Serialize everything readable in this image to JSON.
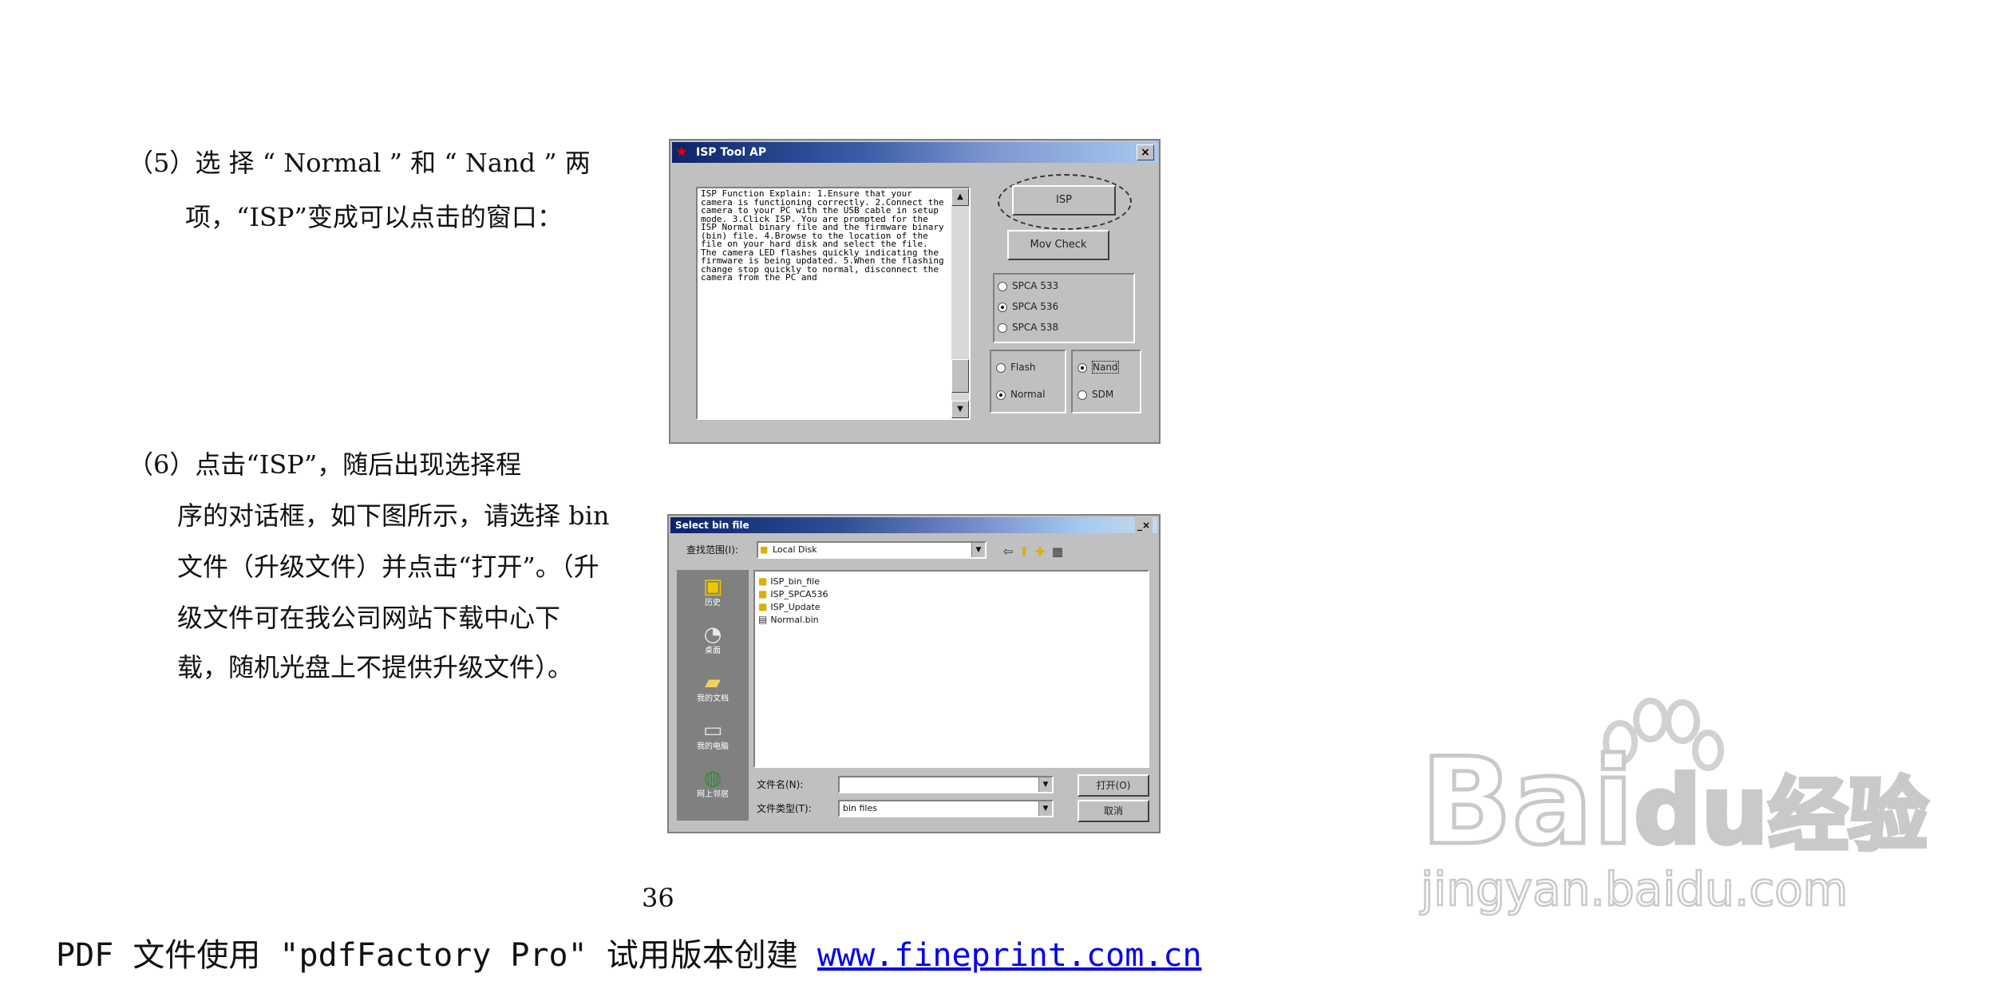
{
  "step5": {
    "line1": "（5）选 择 “ Normal ” 和 “ Nand ” 两",
    "line2": "项，“ISP”变成可以点击的窗口："
  },
  "step6": {
    "line1": "（6）点击“ISP”，随后出现选择程",
    "line2": "序的对话框，如下图所示，请选择 bin",
    "line3": "文件（升级文件）并点击“打开”。（升",
    "line4": "级文件可在我公司网站下载中心下",
    "line5": "载，随机光盘上不提供升级文件）。"
  },
  "isp_window": {
    "title": "ISP Tool AP",
    "close_glyph": "×",
    "instructions": "ISP Function Explain: 1.Ensure that your camera is functioning correctly. 2.Connect the camera to your PC with the USB cable in setup mode. 3.Click ISP. You are prompted for the ISP Normal binary file and the firmware binary (bin) file. 4.Browse to the location of the file on your hard disk and select the file. The camera LED flashes quickly indicating the firmware is being updated. 5.When the flashing change stop quickly to normal, disconnect the camera from the PC and",
    "isp_button": "ISP",
    "second_button": "Mov Check",
    "spca_options": [
      "SPCA 533",
      "SPCA 536",
      "SPCA 538"
    ],
    "spca_selected": 1,
    "mode_options": [
      "Flash",
      "Normal"
    ],
    "mode_selected": 1,
    "mem_options": [
      "Nand",
      "SDM"
    ],
    "mem_selected": 0
  },
  "file_dialog": {
    "title": "Select bin file",
    "lookin_label": "查找范围(I):",
    "lookin_value": "Local Disk",
    "places": [
      "历史",
      "桌面",
      "我的文档",
      "我的电脑",
      "网上邻居"
    ],
    "files": [
      "ISP_bin_file",
      "ISP_SPCA536",
      "ISP_Update",
      "Normal.bin"
    ],
    "filename_label": "文件名(N):",
    "filename_value": "",
    "filetype_label": "文件类型(T):",
    "filetype_value": "bin files",
    "open_button": "打开(O)",
    "cancel_button": "取消",
    "window_glyphs": "_×"
  },
  "page_number": "36",
  "footer": {
    "text": "PDF 文件使用 \"pdfFactory Pro\" 试用版本创建",
    "link": "www.fineprint.com.cn"
  },
  "watermark": {
    "logo_text": "Bai",
    "logo_du": "du",
    "logo_cn": "经验",
    "url": "jingyan.baidu.com"
  }
}
